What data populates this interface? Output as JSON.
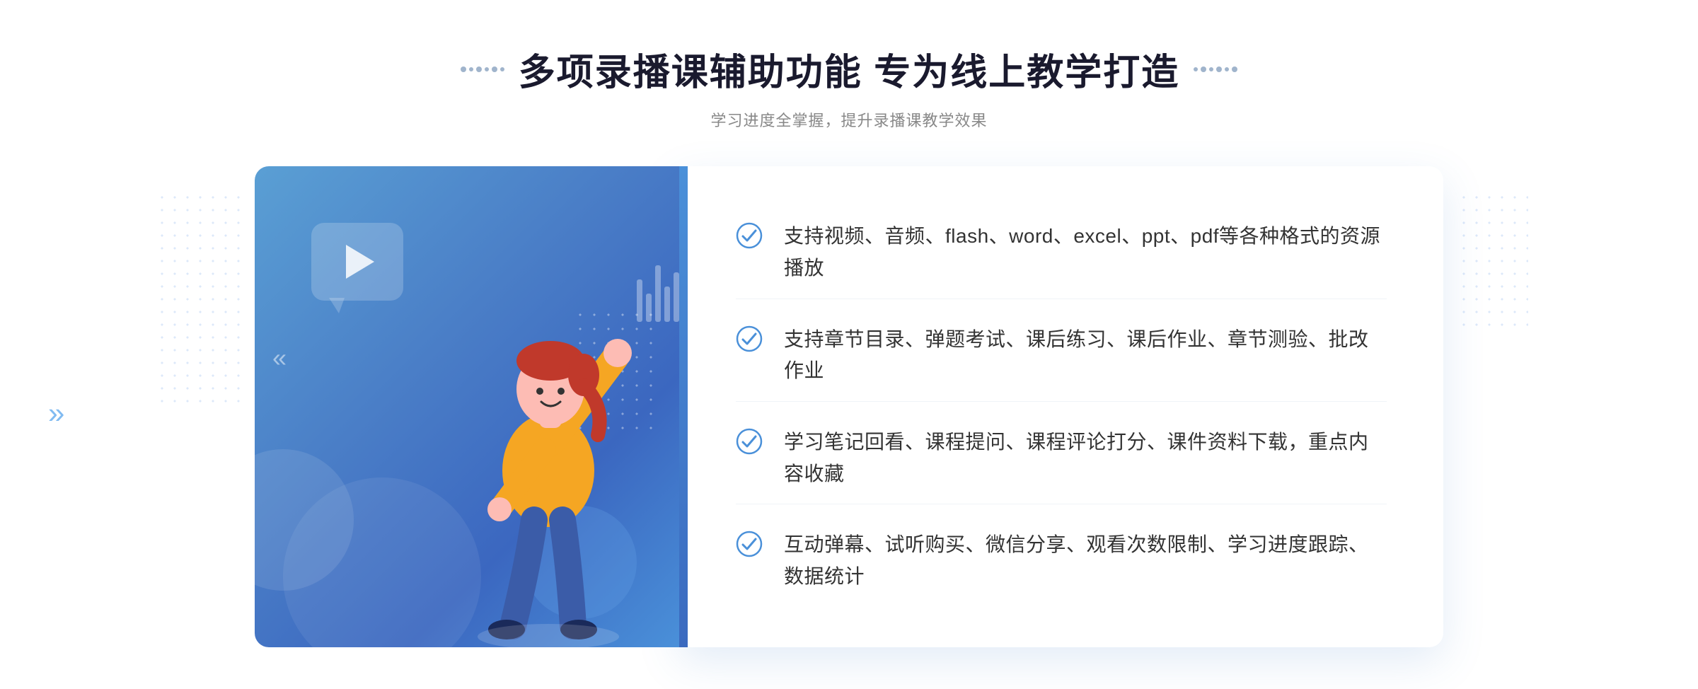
{
  "header": {
    "title": "多项录播课辅助功能 专为线上教学打造",
    "subtitle": "学习进度全掌握，提升录播课教学效果",
    "decorator_left": "⠿",
    "decorator_right": "⠿"
  },
  "features": [
    {
      "id": 1,
      "text": "支持视频、音频、flash、word、excel、ppt、pdf等各种格式的资源播放"
    },
    {
      "id": 2,
      "text": "支持章节目录、弹题考试、课后练习、课后作业、章节测验、批改作业"
    },
    {
      "id": 3,
      "text": "学习笔记回看、课程提问、课程评论打分、课件资料下载，重点内容收藏"
    },
    {
      "id": 4,
      "text": "互动弹幕、试听购买、微信分享、观看次数限制、学习进度跟踪、数据统计"
    }
  ],
  "colors": {
    "title": "#1a1a2e",
    "subtitle": "#888888",
    "feature_text": "#333333",
    "blue_accent": "#4a90d9",
    "check_color": "#4a90d9"
  }
}
